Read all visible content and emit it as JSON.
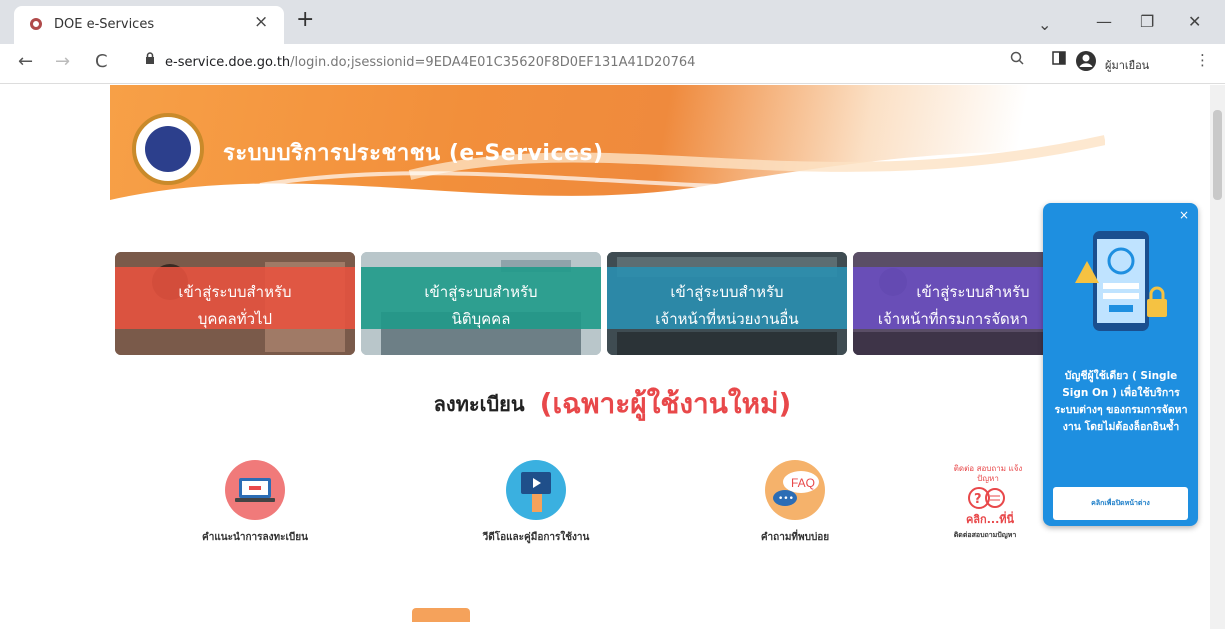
{
  "browser": {
    "tab_title": "DOE e-Services",
    "tab_close": "×",
    "new_tab": "+",
    "url_host": "e-service.doe.go.th",
    "url_path": "/login.do;jsessionid=9EDA4E01C35620F8D0EF131A41D20764",
    "profile_name": "ผู้มาเยือน",
    "controls": {
      "minimize": "—",
      "maximize": "❐",
      "close": "✕",
      "dropdown": "⌄"
    },
    "nav": {
      "back": "←",
      "forward": "→",
      "reload": "C"
    }
  },
  "banner": {
    "title": "ระบบบริการประชาชน (e-Services)",
    "seal_text": "กรมการจัดหางาน"
  },
  "cards": [
    {
      "line1": "เข้าสู่ระบบสำหรับ",
      "line2": "บุคคลทั่วไป",
      "band_color": "#e8523f"
    },
    {
      "line1": "เข้าสู่ระบบสำหรับ",
      "line2": "นิติบุคคล",
      "band_color": "#1f9a8a"
    },
    {
      "line1": "เข้าสู่ระบบสำหรับ",
      "line2": "เจ้าหน้าที่หน่วยงานอื่น",
      "band_color": "#2a8fb0"
    },
    {
      "line1": "เข้าสู่ระบบสำหรับ",
      "line2": "เจ้าหน้าที่กรมการจัดหา",
      "band_color": "#6a4fc0"
    }
  ],
  "register": {
    "label": "ลงทะเบียน",
    "highlight": "(เฉพาะผู้ใช้งานใหม่)"
  },
  "services": [
    {
      "label": "คำแนะนำการลงทะเบียน",
      "icon": "laptop-icon"
    },
    {
      "label": "วีดีโอและคู่มือการใช้งาน",
      "icon": "video-icon"
    },
    {
      "label": "คำถามที่พบบ่อย",
      "icon": "faq-icon"
    },
    {
      "label": "ติดต่อสอบถามปัญหา",
      "icon": "help-click-icon",
      "top_text": "ติดต่อ สอบถาม แจ้งปัญหา",
      "click_text": "คลิก...ที่นี่"
    }
  ],
  "sso": {
    "close": "×",
    "text": "บัญชีผู้ใช้เดียว ( Single Sign On ) เพื่อใช้บริการระบบต่างๆ ของกรมการจัดหางาน โดยไม่ต้องล็อกอินซ้ำ",
    "button": "คลิกเพื่อปิดหน้าต่าง"
  },
  "colors": {
    "banner_orange": "#f28f3b",
    "register_red": "#e8484a",
    "sso_blue": "#1e8fe0"
  }
}
